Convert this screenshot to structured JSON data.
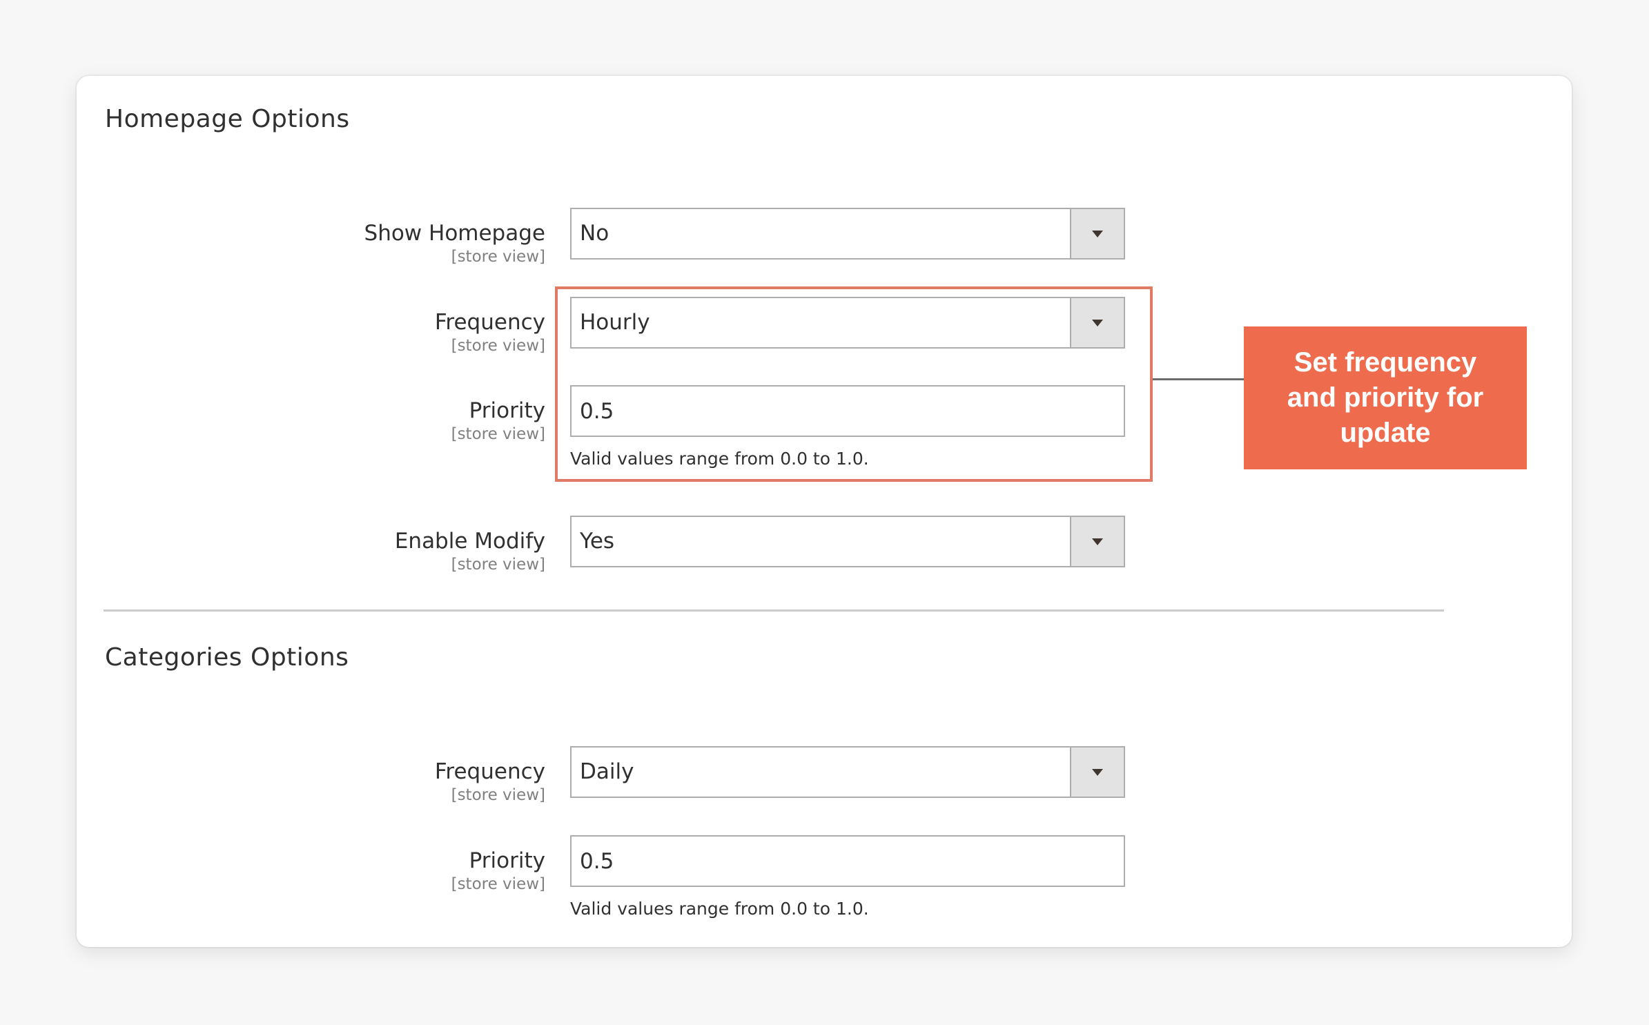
{
  "homepage_section": {
    "title": "Homepage Options",
    "fields": {
      "show_homepage": {
        "label": "Show Homepage",
        "scope": "[store view]",
        "value": "No",
        "type": "select"
      },
      "frequency": {
        "label": "Frequency",
        "scope": "[store view]",
        "value": "Hourly",
        "type": "select"
      },
      "priority": {
        "label": "Priority",
        "scope": "[store view]",
        "value": "0.5",
        "type": "text",
        "help": "Valid values range from 0.0 to 1.0."
      },
      "enable_modify": {
        "label": "Enable Modify",
        "scope": "[store view]",
        "value": "Yes",
        "type": "select"
      }
    }
  },
  "categories_section": {
    "title": "Categories Options",
    "fields": {
      "frequency": {
        "label": "Frequency",
        "scope": "[store view]",
        "value": "Daily",
        "type": "select"
      },
      "priority": {
        "label": "Priority",
        "scope": "[store view]",
        "value": "0.5",
        "type": "text",
        "help": "Valid values range from 0.0 to 1.0."
      }
    }
  },
  "annotation": {
    "text": "Set frequency and priority for update",
    "color": "#ee6c4d",
    "highlight_color": "#e07a63"
  },
  "icons": {
    "dropdown": "caret-down-icon"
  }
}
